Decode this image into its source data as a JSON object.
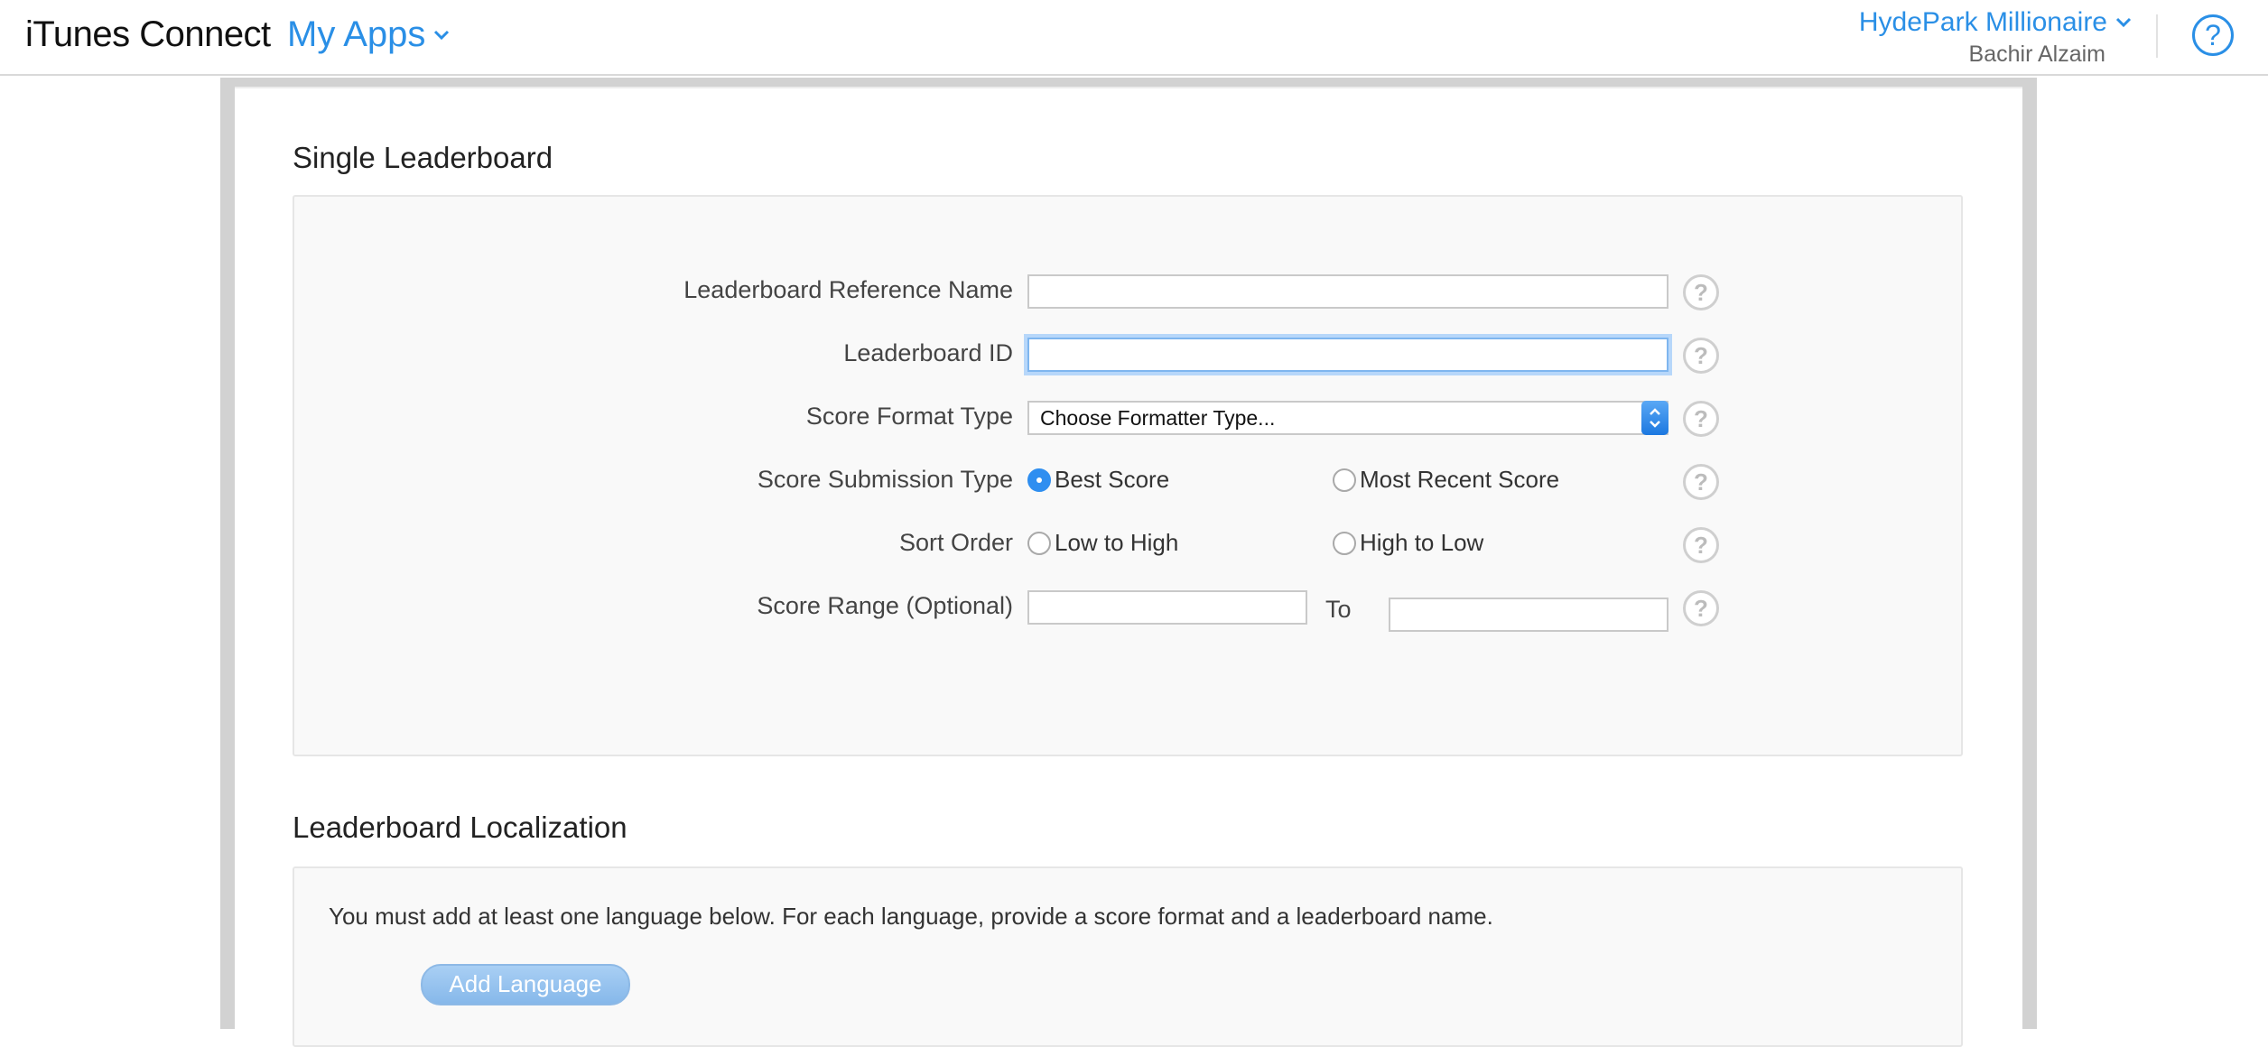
{
  "header": {
    "brand": "iTunes Connect",
    "nav": "My Apps",
    "account_name": "HydePark Millionaire",
    "account_user": "Bachir Alzaim",
    "help_symbol": "?"
  },
  "single_leaderboard": {
    "title": "Single Leaderboard",
    "fields": {
      "reference_name_label": "Leaderboard Reference Name",
      "reference_name_value": "",
      "id_label": "Leaderboard ID",
      "id_value": "",
      "score_format_label": "Score Format Type",
      "score_format_value": "Choose Formatter Type...",
      "submission_type_label": "Score Submission Type",
      "submission_best": "Best Score",
      "submission_recent": "Most Recent Score",
      "submission_selected": "Best Score",
      "sort_order_label": "Sort Order",
      "sort_low_high": "Low to High",
      "sort_high_low": "High to Low",
      "score_range_label": "Score Range (Optional)",
      "score_range_to": "To",
      "score_range_from_value": "",
      "score_range_to_value": ""
    },
    "help_symbol": "?"
  },
  "localization": {
    "title": "Leaderboard Localization",
    "notice": "You must add at least one language below. For each language, provide a score format and a leaderboard name.",
    "add_language_label": "Add Language"
  },
  "icons": {
    "nav_chevron": "chevron-down-icon",
    "account_chevron": "chevron-down-icon",
    "help": "help-circle-icon",
    "select_arrows": "updown-arrows-icon"
  },
  "colors": {
    "accent": "#2a8fe6",
    "panel_bg": "#f9f9f9",
    "frame_bg": "#d2d2d2",
    "focus_ring": "#b7d7fa"
  }
}
